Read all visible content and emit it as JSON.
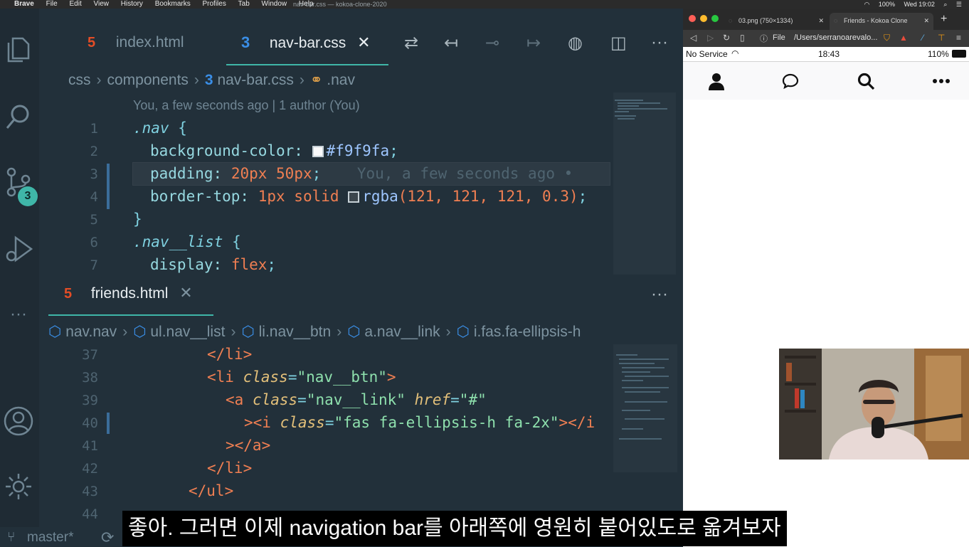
{
  "menubar": {
    "app": "Brave",
    "items": [
      "File",
      "Edit",
      "View",
      "History",
      "Bookmarks",
      "Profiles",
      "Tab",
      "Window",
      "Help"
    ],
    "window_title": "nav-bar.css — kokoa-clone-2020",
    "battery": "100%",
    "clock": "Wed 19:02"
  },
  "editor": {
    "tabs": [
      {
        "label": "index.html",
        "icon": "html5-icon"
      },
      {
        "label": "nav-bar.css",
        "icon": "css3-icon",
        "active": true
      }
    ],
    "close_glyph": "✕",
    "breadcrumb": [
      "css",
      "components",
      "nav-bar.css",
      ".nav"
    ],
    "blame_header": "You, a few seconds ago | 1 author (You)",
    "inline_blame": "You, a few seconds ago •",
    "scm_badge": "3",
    "css_lines": [
      {
        "n": "1",
        "sel": ".nav",
        "punc": " {"
      },
      {
        "n": "2",
        "prop": "background-color:",
        "val": "#f9f9fa",
        "swatch": "#f9f9fa"
      },
      {
        "n": "3",
        "prop": "padding:",
        "val": "20px 50px"
      },
      {
        "n": "4",
        "prop": "border-top:",
        "val1": "1px solid",
        "swatch": "rgba(121,121,121,0.3)",
        "fn": "rgba",
        "args": "(121, 121, 121, 0.3)"
      },
      {
        "n": "5",
        "punc": "}"
      },
      {
        "n": "6",
        "sel": ".nav__list",
        "punc": " {"
      },
      {
        "n": "7",
        "prop": "display:",
        "val": "flex"
      }
    ],
    "split_tab": {
      "label": "friends.html",
      "icon": "html5-icon"
    },
    "split_breadcrumb": [
      "nav.nav",
      "ul.nav__list",
      "li.nav__btn",
      "a.nav__link",
      "i.fas.fa-ellipsis-h"
    ],
    "html_lines": [
      {
        "n": "37",
        "text": "</li>"
      },
      {
        "n": "38",
        "text": "<li class=\"nav__btn\">"
      },
      {
        "n": "39",
        "text": "<a class=\"nav__link\" href=\"#\""
      },
      {
        "n": "40",
        "text": "><i class=\"fas fa-ellipsis-h fa-2x\"></i"
      },
      {
        "n": "41",
        "text": "></a>"
      },
      {
        "n": "42",
        "text": "</li>"
      },
      {
        "n": "43",
        "text": "</ul>"
      },
      {
        "n": "44",
        "text": ""
      }
    ],
    "branch": "master*"
  },
  "browser": {
    "tabs": [
      {
        "label": "03.png (750×1334)"
      },
      {
        "label": "Friends - Kokoa Clone",
        "active": true
      }
    ],
    "url_prefix": "File",
    "url": "/Users/serranoarevalo...",
    "phone": {
      "carrier": "No Service",
      "time": "18:43",
      "battery": "110%",
      "nav_icons": [
        "user-icon",
        "comment-icon",
        "search-icon",
        "ellipsis-icon"
      ]
    }
  },
  "subtitle": "좋아. 그러면 이제 navigation bar를 아래쪽에 영원히 붙어있도로 옮겨보자",
  "colors": {
    "editor_bg": "#22303a",
    "accent": "#3fb6a8",
    "html_icon": "#e44d26",
    "css_icon": "#3a8ee6"
  }
}
